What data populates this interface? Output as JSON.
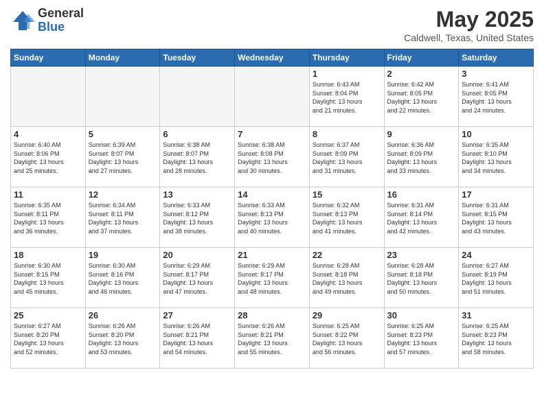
{
  "logo": {
    "general": "General",
    "blue": "Blue"
  },
  "title": "May 2025",
  "subtitle": "Caldwell, Texas, United States",
  "days_of_week": [
    "Sunday",
    "Monday",
    "Tuesday",
    "Wednesday",
    "Thursday",
    "Friday",
    "Saturday"
  ],
  "weeks": [
    [
      {
        "day": "",
        "info": "",
        "empty": true
      },
      {
        "day": "",
        "info": "",
        "empty": true
      },
      {
        "day": "",
        "info": "",
        "empty": true
      },
      {
        "day": "",
        "info": "",
        "empty": true
      },
      {
        "day": "1",
        "info": "Sunrise: 6:43 AM\nSunset: 8:04 PM\nDaylight: 13 hours\nand 21 minutes.",
        "empty": false
      },
      {
        "day": "2",
        "info": "Sunrise: 6:42 AM\nSunset: 8:05 PM\nDaylight: 13 hours\nand 22 minutes.",
        "empty": false
      },
      {
        "day": "3",
        "info": "Sunrise: 6:41 AM\nSunset: 8:05 PM\nDaylight: 13 hours\nand 24 minutes.",
        "empty": false
      }
    ],
    [
      {
        "day": "4",
        "info": "Sunrise: 6:40 AM\nSunset: 8:06 PM\nDaylight: 13 hours\nand 25 minutes.",
        "empty": false
      },
      {
        "day": "5",
        "info": "Sunrise: 6:39 AM\nSunset: 8:07 PM\nDaylight: 13 hours\nand 27 minutes.",
        "empty": false
      },
      {
        "day": "6",
        "info": "Sunrise: 6:38 AM\nSunset: 8:07 PM\nDaylight: 13 hours\nand 28 minutes.",
        "empty": false
      },
      {
        "day": "7",
        "info": "Sunrise: 6:38 AM\nSunset: 8:08 PM\nDaylight: 13 hours\nand 30 minutes.",
        "empty": false
      },
      {
        "day": "8",
        "info": "Sunrise: 6:37 AM\nSunset: 8:09 PM\nDaylight: 13 hours\nand 31 minutes.",
        "empty": false
      },
      {
        "day": "9",
        "info": "Sunrise: 6:36 AM\nSunset: 8:09 PM\nDaylight: 13 hours\nand 33 minutes.",
        "empty": false
      },
      {
        "day": "10",
        "info": "Sunrise: 6:35 AM\nSunset: 8:10 PM\nDaylight: 13 hours\nand 34 minutes.",
        "empty": false
      }
    ],
    [
      {
        "day": "11",
        "info": "Sunrise: 6:35 AM\nSunset: 8:11 PM\nDaylight: 13 hours\nand 36 minutes.",
        "empty": false
      },
      {
        "day": "12",
        "info": "Sunrise: 6:34 AM\nSunset: 8:11 PM\nDaylight: 13 hours\nand 37 minutes.",
        "empty": false
      },
      {
        "day": "13",
        "info": "Sunrise: 6:33 AM\nSunset: 8:12 PM\nDaylight: 13 hours\nand 38 minutes.",
        "empty": false
      },
      {
        "day": "14",
        "info": "Sunrise: 6:33 AM\nSunset: 8:13 PM\nDaylight: 13 hours\nand 40 minutes.",
        "empty": false
      },
      {
        "day": "15",
        "info": "Sunrise: 6:32 AM\nSunset: 8:13 PM\nDaylight: 13 hours\nand 41 minutes.",
        "empty": false
      },
      {
        "day": "16",
        "info": "Sunrise: 6:31 AM\nSunset: 8:14 PM\nDaylight: 13 hours\nand 42 minutes.",
        "empty": false
      },
      {
        "day": "17",
        "info": "Sunrise: 6:31 AM\nSunset: 8:15 PM\nDaylight: 13 hours\nand 43 minutes.",
        "empty": false
      }
    ],
    [
      {
        "day": "18",
        "info": "Sunrise: 6:30 AM\nSunset: 8:15 PM\nDaylight: 13 hours\nand 45 minutes.",
        "empty": false
      },
      {
        "day": "19",
        "info": "Sunrise: 6:30 AM\nSunset: 8:16 PM\nDaylight: 13 hours\nand 46 minutes.",
        "empty": false
      },
      {
        "day": "20",
        "info": "Sunrise: 6:29 AM\nSunset: 8:17 PM\nDaylight: 13 hours\nand 47 minutes.",
        "empty": false
      },
      {
        "day": "21",
        "info": "Sunrise: 6:29 AM\nSunset: 8:17 PM\nDaylight: 13 hours\nand 48 minutes.",
        "empty": false
      },
      {
        "day": "22",
        "info": "Sunrise: 6:28 AM\nSunset: 8:18 PM\nDaylight: 13 hours\nand 49 minutes.",
        "empty": false
      },
      {
        "day": "23",
        "info": "Sunrise: 6:28 AM\nSunset: 8:18 PM\nDaylight: 13 hours\nand 50 minutes.",
        "empty": false
      },
      {
        "day": "24",
        "info": "Sunrise: 6:27 AM\nSunset: 8:19 PM\nDaylight: 13 hours\nand 51 minutes.",
        "empty": false
      }
    ],
    [
      {
        "day": "25",
        "info": "Sunrise: 6:27 AM\nSunset: 8:20 PM\nDaylight: 13 hours\nand 52 minutes.",
        "empty": false
      },
      {
        "day": "26",
        "info": "Sunrise: 6:26 AM\nSunset: 8:20 PM\nDaylight: 13 hours\nand 53 minutes.",
        "empty": false
      },
      {
        "day": "27",
        "info": "Sunrise: 6:26 AM\nSunset: 8:21 PM\nDaylight: 13 hours\nand 54 minutes.",
        "empty": false
      },
      {
        "day": "28",
        "info": "Sunrise: 6:26 AM\nSunset: 8:21 PM\nDaylight: 13 hours\nand 55 minutes.",
        "empty": false
      },
      {
        "day": "29",
        "info": "Sunrise: 6:25 AM\nSunset: 8:22 PM\nDaylight: 13 hours\nand 56 minutes.",
        "empty": false
      },
      {
        "day": "30",
        "info": "Sunrise: 6:25 AM\nSunset: 8:23 PM\nDaylight: 13 hours\nand 57 minutes.",
        "empty": false
      },
      {
        "day": "31",
        "info": "Sunrise: 6:25 AM\nSunset: 8:23 PM\nDaylight: 13 hours\nand 58 minutes.",
        "empty": false
      }
    ]
  ]
}
